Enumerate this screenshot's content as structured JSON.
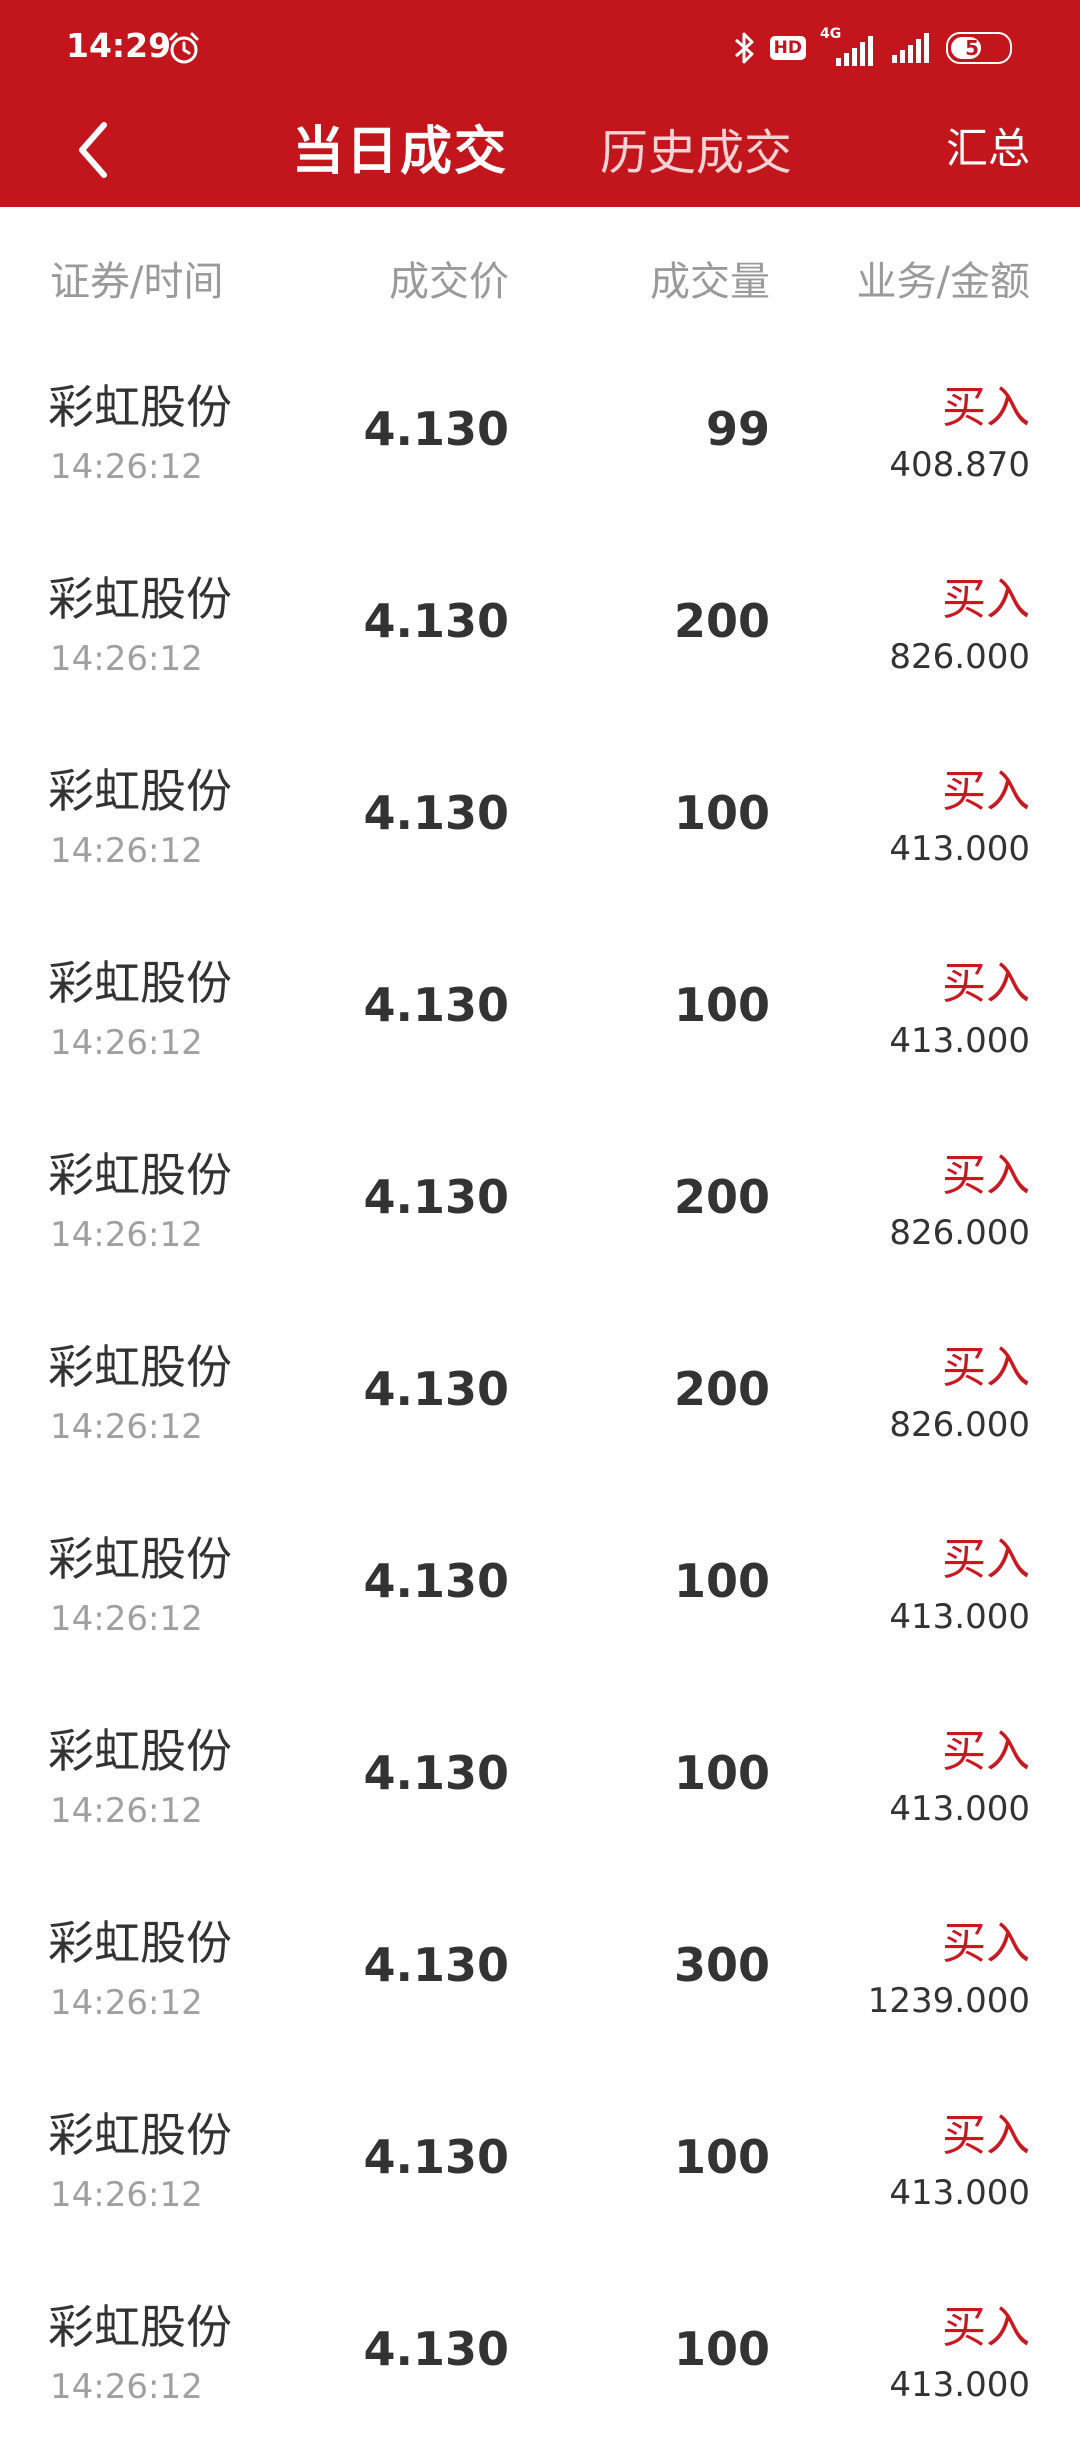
{
  "status_bar": {
    "time": "14:29",
    "hd": "HD",
    "network": "4G",
    "battery": "53",
    "battery_level": 0.53
  },
  "nav": {
    "active_tab": "当日成交",
    "history_tab": "历史成交",
    "summary": "汇总"
  },
  "columns": {
    "security_time": "证券/时间",
    "price": "成交价",
    "quantity": "成交量",
    "business_amount": "业务/金额"
  },
  "trades": [
    {
      "name": "彩虹股份",
      "time": "14:26:12",
      "price": "4.130",
      "qty": "99",
      "action": "买入",
      "amount": "408.870"
    },
    {
      "name": "彩虹股份",
      "time": "14:26:12",
      "price": "4.130",
      "qty": "200",
      "action": "买入",
      "amount": "826.000"
    },
    {
      "name": "彩虹股份",
      "time": "14:26:12",
      "price": "4.130",
      "qty": "100",
      "action": "买入",
      "amount": "413.000"
    },
    {
      "name": "彩虹股份",
      "time": "14:26:12",
      "price": "4.130",
      "qty": "100",
      "action": "买入",
      "amount": "413.000"
    },
    {
      "name": "彩虹股份",
      "time": "14:26:12",
      "price": "4.130",
      "qty": "200",
      "action": "买入",
      "amount": "826.000"
    },
    {
      "name": "彩虹股份",
      "time": "14:26:12",
      "price": "4.130",
      "qty": "200",
      "action": "买入",
      "amount": "826.000"
    },
    {
      "name": "彩虹股份",
      "time": "14:26:12",
      "price": "4.130",
      "qty": "100",
      "action": "买入",
      "amount": "413.000"
    },
    {
      "name": "彩虹股份",
      "time": "14:26:12",
      "price": "4.130",
      "qty": "100",
      "action": "买入",
      "amount": "413.000"
    },
    {
      "name": "彩虹股份",
      "time": "14:26:12",
      "price": "4.130",
      "qty": "300",
      "action": "买入",
      "amount": "1239.000"
    },
    {
      "name": "彩虹股份",
      "time": "14:26:12",
      "price": "4.130",
      "qty": "100",
      "action": "买入",
      "amount": "413.000"
    },
    {
      "name": "彩虹股份",
      "time": "14:26:12",
      "price": "4.130",
      "qty": "100",
      "action": "买入",
      "amount": "413.000"
    }
  ],
  "colors": {
    "brand_red": "#c3161c",
    "buy_red": "#c9181f",
    "muted_text": "#9a9a9a",
    "primary_text": "#333333"
  },
  "icons": {
    "back": "back-arrow-icon",
    "alarm": "alarm-clock-icon",
    "bluetooth": "bluetooth-icon",
    "signal": "cell-signal-icon",
    "battery": "battery-icon"
  }
}
